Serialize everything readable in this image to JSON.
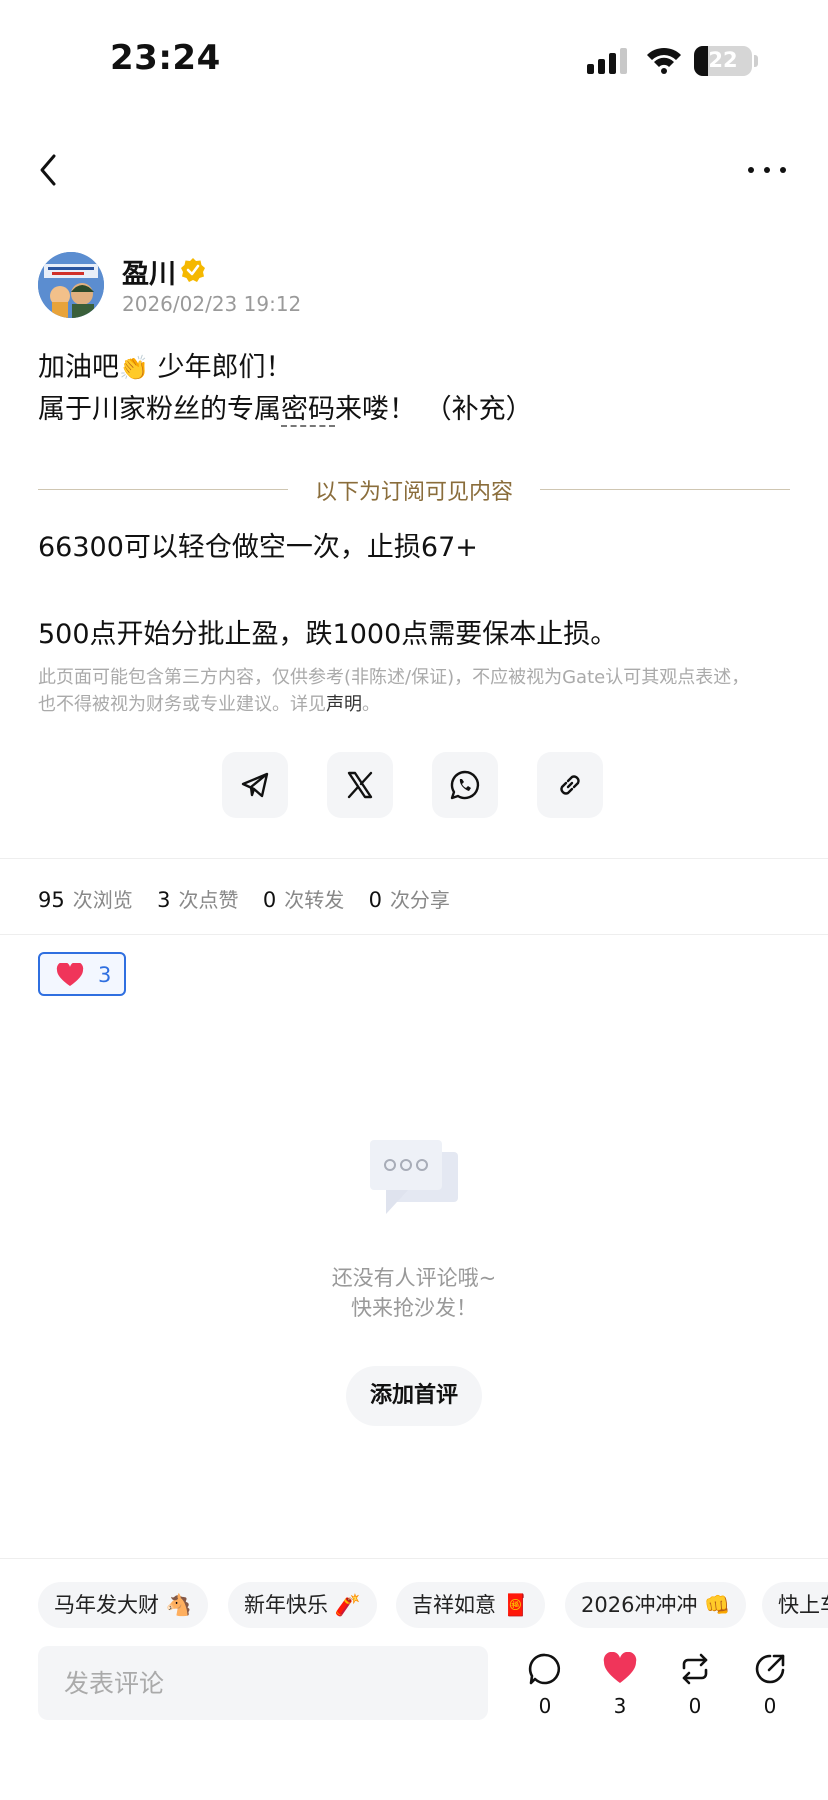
{
  "status_bar": {
    "time": "23:24",
    "battery": "22"
  },
  "author": {
    "name": "盈川",
    "timestamp": "2026/02/23 19:12"
  },
  "post": {
    "line1_a": "加油吧",
    "clap_emoji": "👏",
    "line1_b": " 少年郎们！",
    "line2_a": "属于川家粉丝的专属",
    "line2_b": "密码",
    "line2_c": "来喽！ （补充）",
    "subscriber_divider": "以下为订阅可见内容",
    "body1": "66300可以轻仓做空一次，止损67+",
    "body2": "500点开始分批止盈，跌1000点需要保本止损。",
    "disclaimer_line1": "此页面可能包含第三方内容，仅供参考(非陈述/保证)，不应被视为Gate认可其观点表述，",
    "disclaimer_line2": "也不得被视为财务或专业建议。详见",
    "disclaimer_link": "声明",
    "disclaimer_end": "。"
  },
  "share_buttons": [
    "telegram-icon",
    "x-icon",
    "whatsapp-icon",
    "link-icon"
  ],
  "stats": {
    "views": "95",
    "views_label": "次浏览",
    "likes": "3",
    "likes_label": "次点赞",
    "reposts": "0",
    "reposts_label": "次转发",
    "shares": "0",
    "shares_label": "次分享"
  },
  "reaction": {
    "count": "3"
  },
  "empty_state": {
    "line1": "还没有人评论哦~",
    "line2": "快来抢沙发！",
    "button": "添加首评"
  },
  "quick_replies": [
    "马年发大财 🐴",
    "新年快乐 🧨",
    "吉祥如意 🧧",
    "2026冲冲冲 👊",
    "快上车"
  ],
  "comment_box": {
    "placeholder": "发表评论"
  },
  "actions": {
    "comments": "0",
    "likes": "3",
    "reposts": "0",
    "shares": "0"
  },
  "colors": {
    "accent": "#2f6fe0",
    "heart": "#f0355a",
    "verified": "#f5b800",
    "divider_text": "#8a6d3b"
  }
}
